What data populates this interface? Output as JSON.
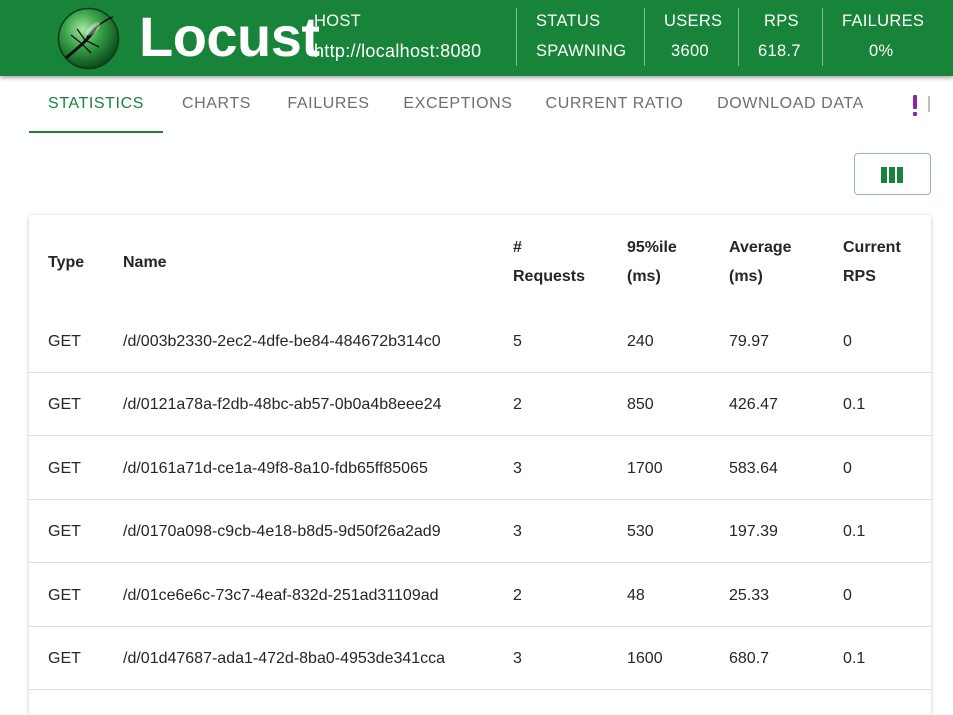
{
  "app": {
    "title": "Locust",
    "colors": {
      "header": "#17843a",
      "accent": "#17843a",
      "more_icon": "#8e24aa"
    }
  },
  "header": {
    "host": {
      "label": "HOST",
      "value": "http://localhost:8080"
    },
    "status": {
      "label": "STATUS",
      "value": "SPAWNING"
    },
    "users": {
      "label": "USERS",
      "value": "3600"
    },
    "rps": {
      "label": "RPS",
      "value": "618.7"
    },
    "failures": {
      "label": "FAILURES",
      "value": "0%"
    }
  },
  "tabs": [
    {
      "label": "STATISTICS",
      "active": true
    },
    {
      "label": "CHARTS"
    },
    {
      "label": "FAILURES"
    },
    {
      "label": "EXCEPTIONS"
    },
    {
      "label": "CURRENT RATIO"
    },
    {
      "label": "DOWNLOAD DATA"
    }
  ],
  "icons": {
    "more": "exclamation-icon",
    "columns": "view-column-icon",
    "logo": "locust-logo-icon"
  },
  "table": {
    "headers": {
      "type": "Type",
      "name": "Name",
      "requests_1": "#",
      "requests_2": "Requests",
      "p95_1": "95%ile",
      "p95_2": "(ms)",
      "avg_1": "Average",
      "avg_2": "(ms)",
      "rps_1": "Current",
      "rps_2": "RPS"
    },
    "rows": [
      {
        "type": "GET",
        "name": "/d/003b2330-2ec2-4dfe-be84-484672b314c0",
        "requests": "5",
        "p95": "240",
        "avg": "79.97",
        "rps": "0"
      },
      {
        "type": "GET",
        "name": "/d/0121a78a-f2db-48bc-ab57-0b0a4b8eee24",
        "requests": "2",
        "p95": "850",
        "avg": "426.47",
        "rps": "0.1"
      },
      {
        "type": "GET",
        "name": "/d/0161a71d-ce1a-49f8-8a10-fdb65ff85065",
        "requests": "3",
        "p95": "1700",
        "avg": "583.64",
        "rps": "0"
      },
      {
        "type": "GET",
        "name": "/d/0170a098-c9cb-4e18-b8d5-9d50f26a2ad9",
        "requests": "3",
        "p95": "530",
        "avg": "197.39",
        "rps": "0.1"
      },
      {
        "type": "GET",
        "name": "/d/01ce6e6c-73c7-4eaf-832d-251ad31109ad",
        "requests": "2",
        "p95": "48",
        "avg": "25.33",
        "rps": "0"
      },
      {
        "type": "GET",
        "name": "/d/01d47687-ada1-472d-8ba0-4953de341cca",
        "requests": "3",
        "p95": "1600",
        "avg": "680.7",
        "rps": "0.1"
      }
    ]
  }
}
